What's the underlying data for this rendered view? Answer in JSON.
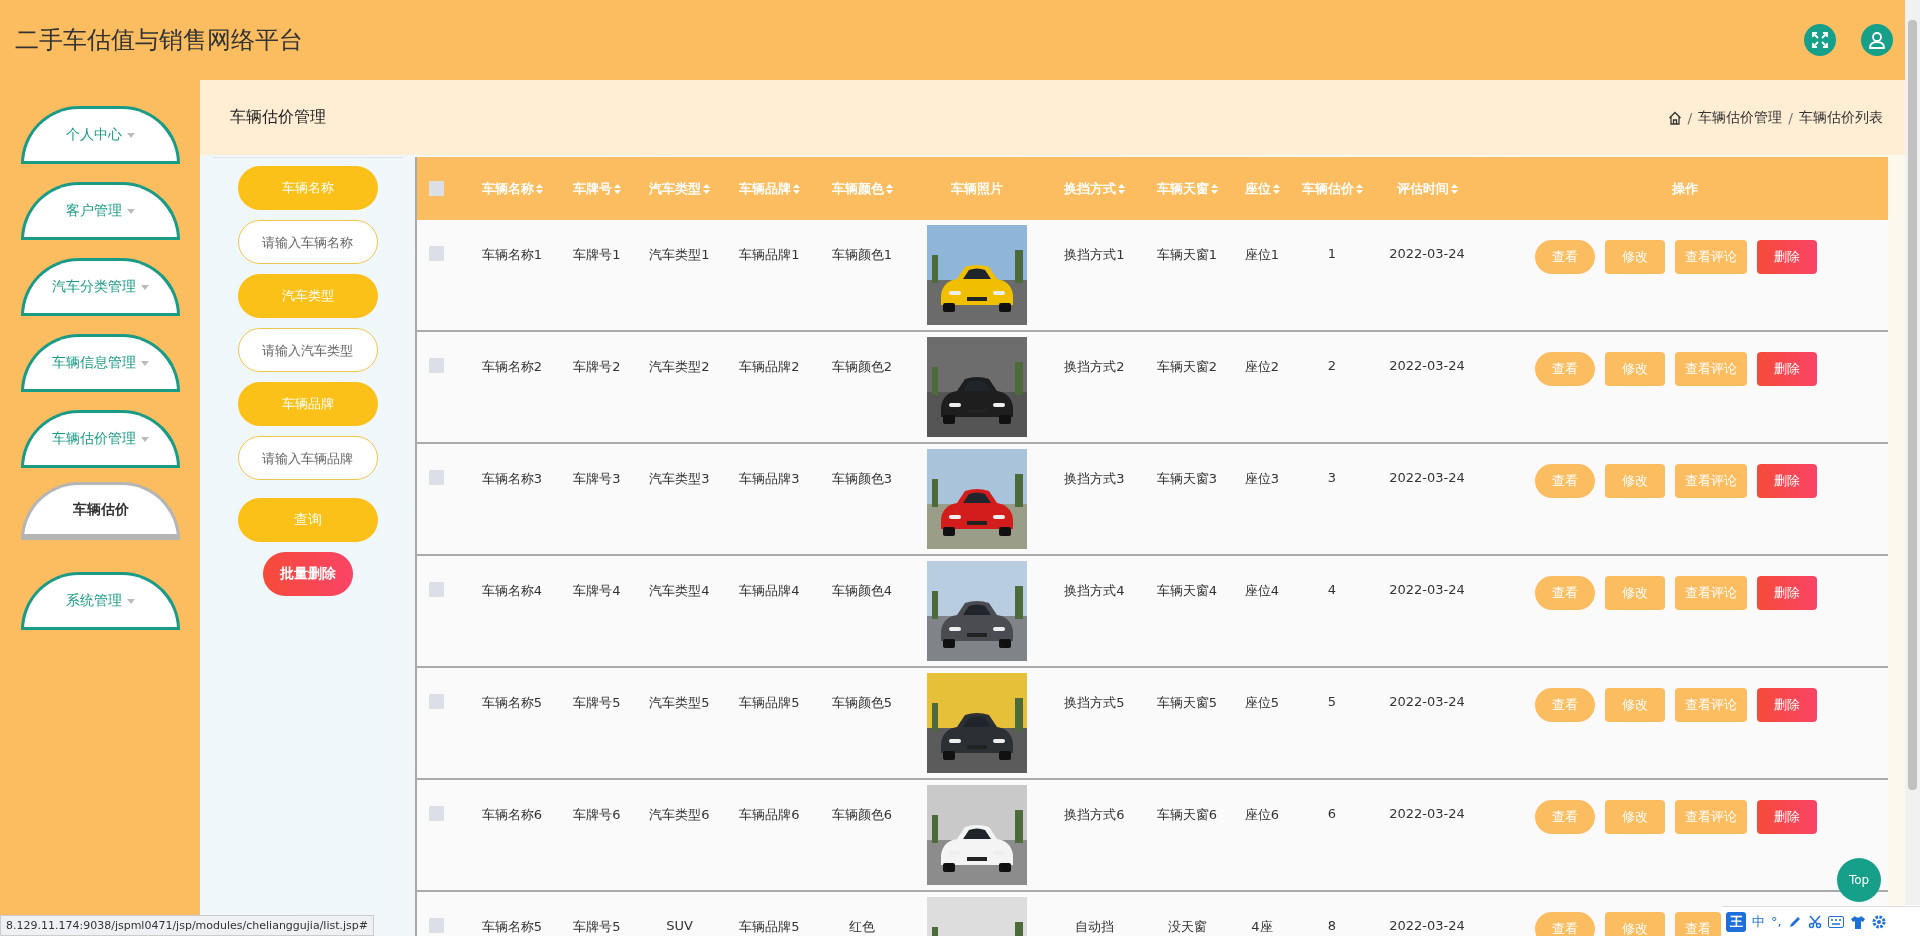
{
  "header": {
    "title": "二手车估值与销售网络平台"
  },
  "sidebar": {
    "items": [
      {
        "label": "个人中心"
      },
      {
        "label": "客户管理"
      },
      {
        "label": "汽车分类管理"
      },
      {
        "label": "车辆信息管理"
      },
      {
        "label": "车辆估价管理",
        "children": [
          {
            "label": "车辆估价"
          }
        ]
      },
      {
        "label": "系统管理"
      }
    ]
  },
  "page_title": "车辆估价管理",
  "breadcrumb": [
    {
      "kind": "separator",
      "text": "/"
    },
    {
      "kind": "link",
      "text": "车辆估价管理"
    },
    {
      "kind": "separator",
      "text": "/"
    },
    {
      "kind": "link",
      "text": "车辆估价列表"
    }
  ],
  "filters": [
    {
      "label": "车辆名称",
      "placeholder": "请输入车辆名称"
    },
    {
      "label": "汽车类型",
      "placeholder": "请输入汽车类型"
    },
    {
      "label": "车辆品牌",
      "placeholder": "请输入车辆品牌"
    }
  ],
  "filter_buttons": [
    {
      "label": "查询",
      "kind": "search"
    },
    {
      "label": "批量删除",
      "kind": "delete"
    }
  ],
  "table": {
    "select_all": {
      "checked": false
    },
    "columns": [
      {
        "kind": "text",
        "label": "车辆名称",
        "sortable": true
      },
      {
        "kind": "text",
        "label": "车牌号",
        "sortable": true
      },
      {
        "kind": "text",
        "label": "汽车类型",
        "sortable": true
      },
      {
        "kind": "text",
        "label": "车辆品牌",
        "sortable": true
      },
      {
        "kind": "text",
        "label": "车辆颜色",
        "sortable": true
      },
      {
        "label": "车辆照片",
        "sortable": false
      },
      {
        "kind": "text",
        "label": "换挡方式",
        "sortable": true
      },
      {
        "kind": "text",
        "label": "车辆天窗",
        "sortable": true
      },
      {
        "kind": "text",
        "label": "座位",
        "sortable": true
      },
      {
        "kind": "text",
        "label": "车辆估价",
        "sortable": true
      },
      {
        "kind": "text",
        "label": "评估时间",
        "sortable": true
      },
      {
        "kind": "actions",
        "label": "操作",
        "sortable": false
      }
    ],
    "rows": [
      {
        "checked": false,
        "cells": [
          "车辆名称1",
          "车牌号1",
          "汽车类型1",
          "车辆品牌1",
          "车辆颜色1",
          {
            "kind": "picture"
          },
          "换挡方式1",
          "车辆天窗1",
          "座位1",
          "1",
          "2022-03-24"
        ],
        "actions": [
          {
            "label": "查看",
            "kind": "view"
          },
          {
            "label": "修改",
            "kind": "edit"
          },
          {
            "label": "查看评论",
            "kind": "comment"
          },
          {
            "label": "删除",
            "kind": "delete"
          }
        ]
      },
      {
        "checked": false,
        "cells": [
          "车辆名称2",
          "车牌号2",
          "汽车类型2",
          "车辆品牌2",
          "车辆颜色2",
          {
            "kind": "picture"
          },
          "换挡方式2",
          "车辆天窗2",
          "座位2",
          "2",
          "2022-03-24"
        ],
        "actions": [
          {
            "label": "查看",
            "kind": "view"
          },
          {
            "label": "修改",
            "kind": "edit"
          },
          {
            "label": "查看评论",
            "kind": "comment"
          },
          {
            "label": "删除",
            "kind": "delete"
          }
        ]
      },
      {
        "checked": false,
        "cells": [
          "车辆名称3",
          "车牌号3",
          "汽车类型3",
          "车辆品牌3",
          "车辆颜色3",
          {
            "kind": "picture"
          },
          "换挡方式3",
          "车辆天窗3",
          "座位3",
          "3",
          "2022-03-24"
        ],
        "actions": [
          {
            "label": "查看",
            "kind": "view"
          },
          {
            "label": "修改",
            "kind": "edit"
          },
          {
            "label": "查看评论",
            "kind": "comment"
          },
          {
            "label": "删除",
            "kind": "delete"
          }
        ]
      },
      {
        "checked": false,
        "cells": [
          "车辆名称4",
          "车牌号4",
          "汽车类型4",
          "车辆品牌4",
          "车辆颜色4",
          {
            "kind": "picture"
          },
          "换挡方式4",
          "车辆天窗4",
          "座位4",
          "4",
          "2022-03-24"
        ],
        "actions": [
          {
            "label": "查看",
            "kind": "view"
          },
          {
            "label": "修改",
            "kind": "edit"
          },
          {
            "label": "查看评论",
            "kind": "comment"
          },
          {
            "label": "删除",
            "kind": "delete"
          }
        ]
      },
      {
        "checked": false,
        "cells": [
          "车辆名称5",
          "车牌号5",
          "汽车类型5",
          "车辆品牌5",
          "车辆颜色5",
          {
            "kind": "picture"
          },
          "换挡方式5",
          "车辆天窗5",
          "座位5",
          "5",
          "2022-03-24"
        ],
        "actions": [
          {
            "label": "查看",
            "kind": "view"
          },
          {
            "label": "修改",
            "kind": "edit"
          },
          {
            "label": "查看评论",
            "kind": "comment"
          },
          {
            "label": "删除",
            "kind": "delete"
          }
        ]
      },
      {
        "checked": false,
        "cells": [
          "车辆名称6",
          "车牌号6",
          "汽车类型6",
          "车辆品牌6",
          "车辆颜色6",
          {
            "kind": "picture"
          },
          "换挡方式6",
          "车辆天窗6",
          "座位6",
          "6",
          "2022-03-24"
        ],
        "actions": [
          {
            "label": "查看",
            "kind": "view"
          },
          {
            "label": "修改",
            "kind": "edit"
          },
          {
            "label": "查看评论",
            "kind": "comment"
          },
          {
            "label": "删除",
            "kind": "delete"
          }
        ]
      },
      {
        "checked": false,
        "cells": [
          "车辆名称5",
          "车牌号5",
          "SUV",
          "车辆品牌5",
          "红色",
          {
            "kind": "picture"
          },
          "自动挡",
          "没天窗",
          "4座",
          "8",
          "2022-03-24"
        ],
        "actions": [
          {
            "label": "查看",
            "kind": "view"
          },
          {
            "label": "修改",
            "kind": "edit"
          },
          {
            "label": "查看",
            "kind": "comment"
          }
        ]
      }
    ]
  },
  "top_button": {
    "label": "Top"
  },
  "status_url": "8.129.11.174:9038/jspml0471/jsp/modules/chelianggujia/list.jsp#",
  "ime_bar": {
    "logo": "王",
    "mode": "中",
    "punct": "°,"
  }
}
